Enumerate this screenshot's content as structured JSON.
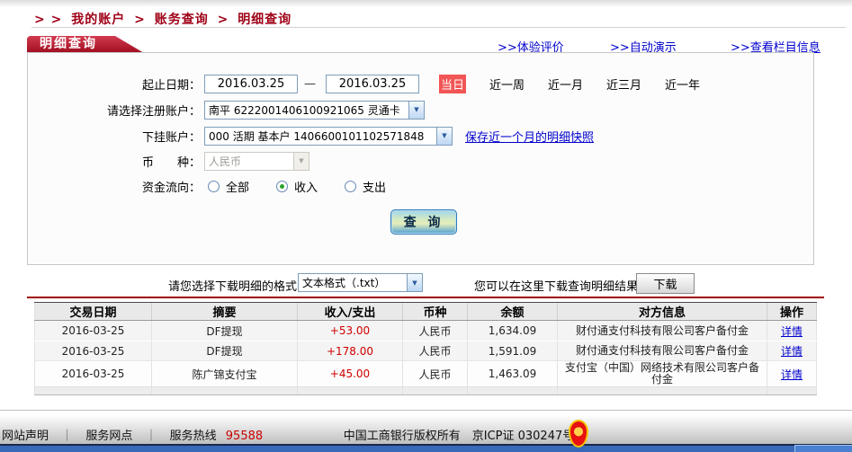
{
  "breadcrumb": {
    "prefix": "> >",
    "separator": ">",
    "items": [
      "我的账户",
      "账务查询",
      "明细查询"
    ]
  },
  "panel_tab": {
    "title": "明细查询"
  },
  "top_links": {
    "prefix": ">>",
    "items": [
      "体验评价",
      "自动演示",
      "查看栏目信息"
    ]
  },
  "form": {
    "date_label": "起止日期：",
    "date_from": "2016.03.25",
    "dash": "—",
    "date_to": "2016.03.25",
    "today_button": "当日",
    "quick_ranges": [
      "近一周",
      "近一月",
      "近三月",
      "近一年"
    ],
    "register_account_label": "请选择注册账户：",
    "register_account_value": "南平  6222001406100921065  灵通卡",
    "sub_account_label": "下挂账户：",
    "sub_account_value": "000 活期 基本户 1406600101102571848",
    "snapshot_link": "保存近一个月的明细快照",
    "currency_label": "币　　种：",
    "currency_value": "人民币",
    "flow_label": "资金流向：",
    "flow_options": [
      {
        "label": "全部",
        "selected": false
      },
      {
        "label": "收入",
        "selected": true
      },
      {
        "label": "支出",
        "selected": false
      }
    ],
    "query_button": "查 询"
  },
  "download": {
    "format_label": "请您选择下载明细的格式",
    "format_value": "文本格式（.txt）",
    "result_label": "您可以在这里下载查询明细结果",
    "download_button": "下载"
  },
  "table": {
    "headers": [
      "交易日期",
      "摘要",
      "收入/支出",
      "币种",
      "余额",
      "对方信息",
      "操作"
    ],
    "rows": [
      {
        "date": "2016-03-25",
        "summary": "DF提现",
        "amount": "+53.00",
        "currency": "人民币",
        "balance": "1,634.09",
        "counterparty": "财付通支付科技有限公司客户备付金",
        "action": "详情"
      },
      {
        "date": "2016-03-25",
        "summary": "DF提现",
        "amount": "+178.00",
        "currency": "人民币",
        "balance": "1,591.09",
        "counterparty": "财付通支付科技有限公司客户备付金",
        "action": "详情"
      },
      {
        "date": "2016-03-25",
        "summary": "陈广锦支付宝",
        "amount": "+45.00",
        "currency": "人民币",
        "balance": "1,463.09",
        "counterparty": "支付宝（中国）网络技术有限公司客户备付金",
        "action": "详情"
      }
    ]
  },
  "footer": {
    "link_statement": "网站声明",
    "link_branches": "服务网点",
    "separator": "｜",
    "hotline_label": "服务热线",
    "hotline_number": "95588",
    "copyright": "中国工商银行版权所有　京ICP证 030247号"
  },
  "colors": {
    "brand_dark_red": "#9e0016",
    "tab_red": "#a00d20",
    "today_button_red": "#f25555",
    "amount_red": "#d00000",
    "link_blue": "#0000cc",
    "footer_bar_blue": "#3a68b8",
    "table_header_gray": "#e9e9e9"
  }
}
